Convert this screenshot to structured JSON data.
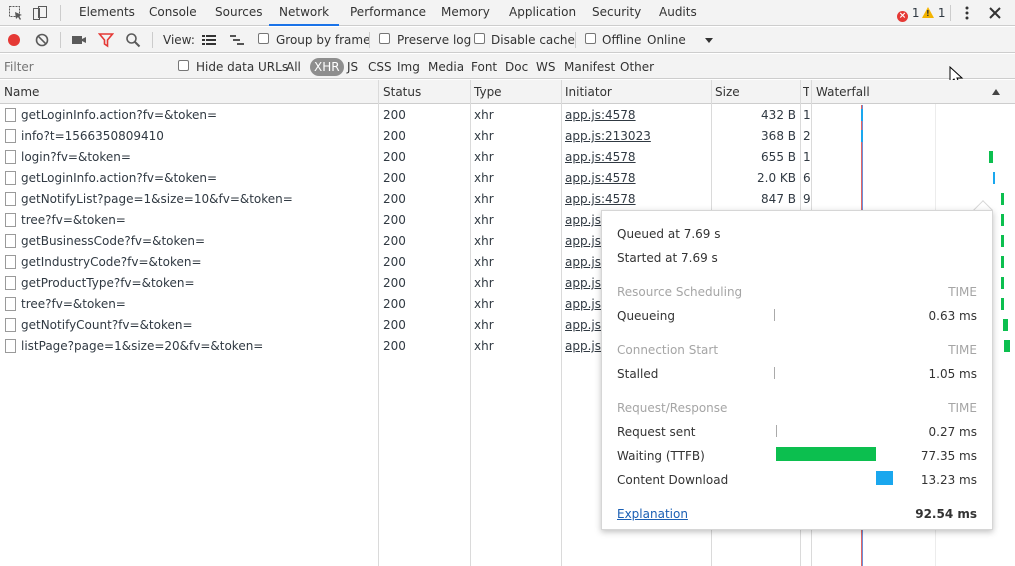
{
  "tabs": [
    "Elements",
    "Console",
    "Sources",
    "Network",
    "Performance",
    "Memory",
    "Application",
    "Security",
    "Audits"
  ],
  "active_tab": "Network",
  "errors_count": "1",
  "warnings_count": "1",
  "toolbar": {
    "view_label": "View:",
    "group_by_frame": "Group by frame",
    "preserve_log": "Preserve log",
    "disable_cache": "Disable cache",
    "offline": "Offline",
    "throttle": "Online"
  },
  "filterbar": {
    "placeholder": "Filter",
    "hide_data_urls": "Hide data URLs",
    "types": [
      "All",
      "XHR",
      "JS",
      "CSS",
      "Img",
      "Media",
      "Font",
      "Doc",
      "WS",
      "Manifest",
      "Other"
    ],
    "active_type": "XHR"
  },
  "columns": {
    "name": "Name",
    "status": "Status",
    "type": "Type",
    "initiator": "Initiator",
    "size": "Size",
    "time": "T",
    "waterfall": "Waterfall"
  },
  "rows": [
    {
      "name": "getLoginInfo.action?fv=&token=",
      "status": "200",
      "type": "xhr",
      "initiator": "app.js:4578",
      "size": "432 B",
      "time": "1"
    },
    {
      "name": "info?t=1566350809410",
      "status": "200",
      "type": "xhr",
      "initiator": "app.js:213023",
      "size": "368 B",
      "time": "2"
    },
    {
      "name": "login?fv=&token=",
      "status": "200",
      "type": "xhr",
      "initiator": "app.js:4578",
      "size": "655 B",
      "time": "1"
    },
    {
      "name": "getLoginInfo.action?fv=&token=",
      "status": "200",
      "type": "xhr",
      "initiator": "app.js:4578",
      "size": "2.0 KB",
      "time": "6"
    },
    {
      "name": "getNotifyList?page=1&size=10&fv=&token=",
      "status": "200",
      "type": "xhr",
      "initiator": "app.js:4578",
      "size": "847 B",
      "time": "9"
    },
    {
      "name": "tree?fv=&token=",
      "status": "200",
      "type": "xhr",
      "initiator": "app.js:4",
      "size": "",
      "time": ""
    },
    {
      "name": "getBusinessCode?fv=&token=",
      "status": "200",
      "type": "xhr",
      "initiator": "app.js:4",
      "size": "",
      "time": ""
    },
    {
      "name": "getIndustryCode?fv=&token=",
      "status": "200",
      "type": "xhr",
      "initiator": "app.js:4",
      "size": "",
      "time": ""
    },
    {
      "name": "getProductType?fv=&token=",
      "status": "200",
      "type": "xhr",
      "initiator": "app.js:4",
      "size": "",
      "time": ""
    },
    {
      "name": "tree?fv=&token=",
      "status": "200",
      "type": "xhr",
      "initiator": "app.js:4",
      "size": "",
      "time": ""
    },
    {
      "name": "getNotifyCount?fv=&token=",
      "status": "200",
      "type": "xhr",
      "initiator": "app.js:4",
      "size": "",
      "time": ""
    },
    {
      "name": "listPage?page=1&size=20&fv=&token=",
      "status": "200",
      "type": "xhr",
      "initiator": "app.js:4",
      "size": "",
      "time": ""
    }
  ],
  "timing": {
    "queued": "Queued at 7.69 s",
    "started": "Started at 7.69 s",
    "section_time_label": "TIME",
    "resource_scheduling": "Resource Scheduling",
    "queueing_label": "Queueing",
    "queueing_value": "0.63 ms",
    "connection_start": "Connection Start",
    "stalled_label": "Stalled",
    "stalled_value": "1.05 ms",
    "request_response": "Request/Response",
    "request_sent_label": "Request sent",
    "request_sent_value": "0.27 ms",
    "waiting_label": "Waiting (TTFB)",
    "waiting_value": "77.35 ms",
    "content_download_label": "Content Download",
    "content_download_value": "13.23 ms",
    "explanation": "Explanation",
    "total": "92.54 ms",
    "waiting_fraction": 0.836,
    "download_fraction": 0.143
  },
  "colors": {
    "waiting": "#0cbf4f",
    "download": "#1aa7ee",
    "record": "#e53935",
    "filter_active": "#e53935",
    "tab_underline": "#1a73e8"
  }
}
